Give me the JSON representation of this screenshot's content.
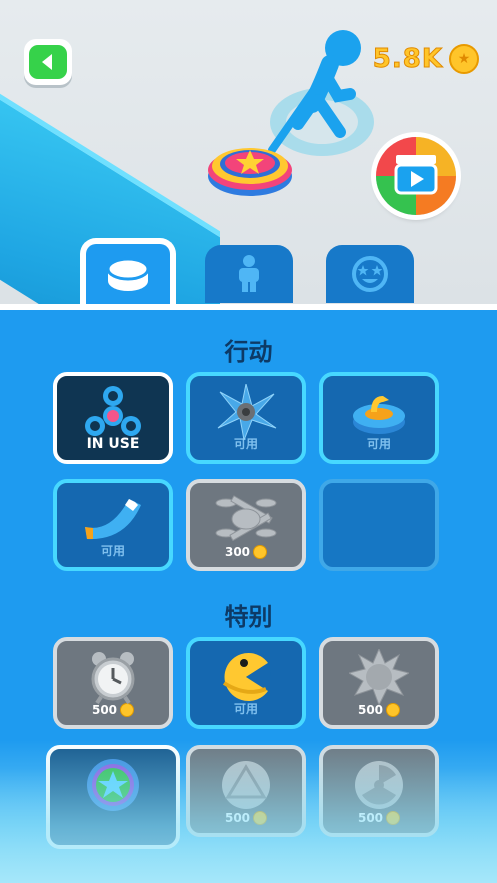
{
  "hud": {
    "coins": "5.8K"
  },
  "tabs": [
    {
      "name": "throwable-tab",
      "icon": "disc-icon",
      "active": true
    },
    {
      "name": "character-tab",
      "icon": "person-icon",
      "active": false
    },
    {
      "name": "emote-tab",
      "icon": "star-eyes-face-icon",
      "active": false
    }
  ],
  "sections": {
    "action_title": "行动",
    "special_title": "特别"
  },
  "action_items": [
    {
      "icon": "fidget-spinner-icon",
      "status": "IN USE"
    },
    {
      "icon": "shuriken-icon",
      "status": "可用"
    },
    {
      "icon": "curling-stone-icon",
      "status": "可用"
    },
    {
      "icon": "boomerang-icon",
      "status": "可用"
    },
    {
      "icon": "drone-icon",
      "price": "300"
    },
    {
      "icon": "empty-slot",
      "status": ""
    }
  ],
  "special_items": [
    {
      "icon": "alarm-clock-icon",
      "price": "500"
    },
    {
      "icon": "pacman-icon",
      "status": "可用"
    },
    {
      "icon": "spiked-ball-icon",
      "price": "500"
    },
    {
      "icon": "star-disc-icon",
      "status": ""
    },
    {
      "icon": "triangle-disc-icon",
      "price": "500"
    },
    {
      "icon": "radiation-disc-icon",
      "price": "500"
    }
  ]
}
